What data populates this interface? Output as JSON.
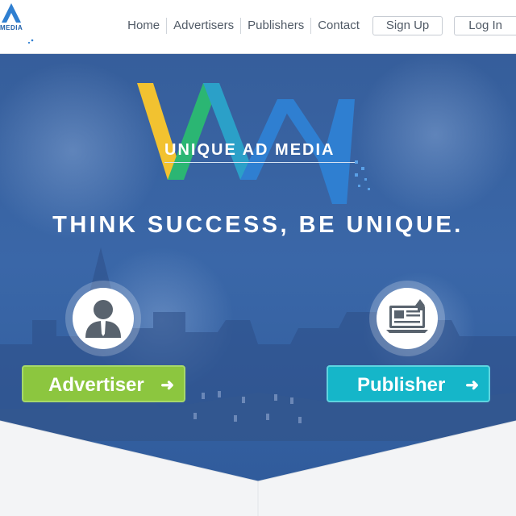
{
  "header": {
    "logo_text": "MEDIA",
    "nav": [
      "Home",
      "Advertisers",
      "Publishers",
      "Contact"
    ],
    "signup_label": "Sign Up",
    "login_label": "Log In"
  },
  "hero": {
    "brand_name": "UNIQUE AD MEDIA",
    "tagline": "THINK SUCCESS, BE UNIQUE.",
    "advertiser_label": "Advertiser",
    "publisher_label": "Publisher"
  },
  "colors": {
    "hero_blue": "#3a67a8",
    "advertiser_green": "#8cc63f",
    "publisher_cyan": "#15b6c9",
    "logo_yellow": "#f2c230",
    "logo_green": "#2bb673",
    "logo_blue": "#2f7fd1"
  }
}
